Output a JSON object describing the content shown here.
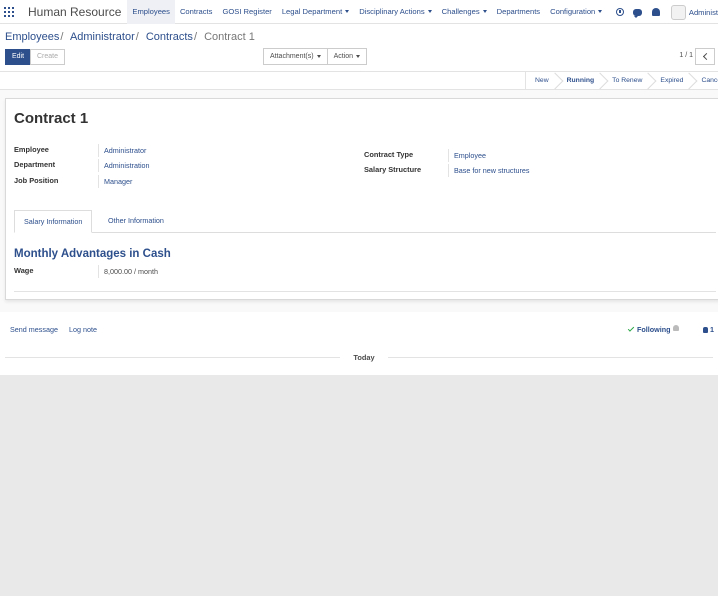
{
  "navbar": {
    "app_name": "Human Resource",
    "menu": [
      {
        "label": "Employees",
        "active": true,
        "dropdown": false
      },
      {
        "label": "Contracts",
        "active": false,
        "dropdown": false
      },
      {
        "label": "GOSI Register",
        "active": false,
        "dropdown": false
      },
      {
        "label": "Legal Department",
        "active": false,
        "dropdown": true
      },
      {
        "label": "Disciplinary Actions",
        "active": false,
        "dropdown": true
      },
      {
        "label": "Challenges",
        "active": false,
        "dropdown": true
      },
      {
        "label": "Departments",
        "active": false,
        "dropdown": false
      },
      {
        "label": "Configuration",
        "active": false,
        "dropdown": true
      }
    ],
    "user_name": "Administ",
    "icons": [
      "apps-icon",
      "clock-icon",
      "chat-icon",
      "bell-icon"
    ]
  },
  "breadcrumb": {
    "items": [
      "Employees",
      "Administrator",
      "Contracts"
    ],
    "current": "Contract 1"
  },
  "buttons": {
    "edit": "Edit",
    "create": "Create",
    "attachments": "Attachment(s)",
    "action": "Action"
  },
  "pager": {
    "value": "1 / 1"
  },
  "stages": [
    {
      "label": "New",
      "active": false
    },
    {
      "label": "Running",
      "active": true
    },
    {
      "label": "To Renew",
      "active": false
    },
    {
      "label": "Expired",
      "active": false
    },
    {
      "label": "Cancel",
      "active": false
    }
  ],
  "form": {
    "title": "Contract 1",
    "employee_label": "Employee",
    "employee_value": "Administrator",
    "department_label": "Department",
    "department_value": "Administration",
    "job_position_label": "Job Position",
    "job_position_value": "Manager",
    "contract_type_label": "Contract Type",
    "contract_type_value": "Employee",
    "salary_structure_label": "Salary Structure",
    "salary_structure_value": "Base for new structures"
  },
  "tabs": [
    {
      "label": "Salary Information",
      "active": true
    },
    {
      "label": "Other Information",
      "active": false
    }
  ],
  "salary": {
    "section_title": "Monthly Advantages in Cash",
    "wage_label": "Wage",
    "wage_value": "8,000.00 / month"
  },
  "chatter": {
    "send_message": "Send message",
    "log_note": "Log note",
    "following": "Following",
    "followers_count": "1",
    "today": "Today"
  },
  "colors": {
    "brand": "#2d4f8c",
    "following_check": "#28a745"
  }
}
